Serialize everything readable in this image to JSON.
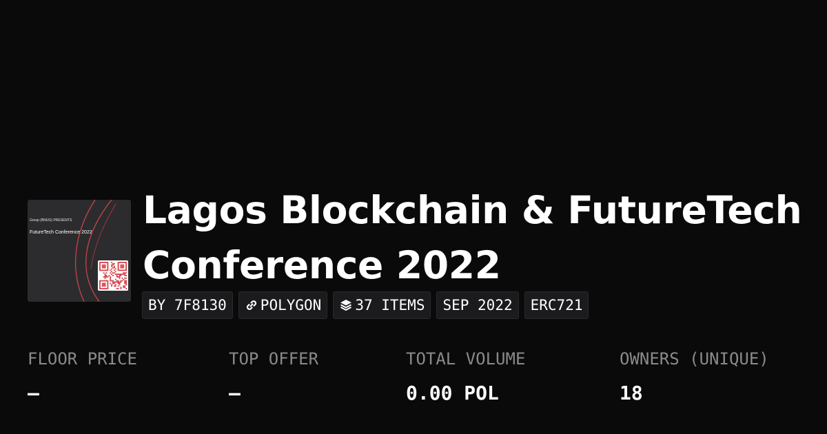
{
  "collection": {
    "title": "Lagos Blockchain & FutureTech Conference 2022",
    "thumbnail": {
      "line1": "Group (BNUG) PRESENTS",
      "line2": "FutureTech Conference 2022"
    }
  },
  "chips": [
    {
      "label": "BY 7F8130"
    },
    {
      "label": "POLYGON",
      "icon": "link-icon"
    },
    {
      "label": "37 ITEMS",
      "icon": "layers-icon"
    },
    {
      "label": "SEP 2022"
    },
    {
      "label": "ERC721"
    }
  ],
  "stats": [
    {
      "label": "FLOOR PRICE",
      "value": "–"
    },
    {
      "label": "TOP OFFER",
      "value": "–"
    },
    {
      "label": "TOTAL VOLUME",
      "value": "0.00 POL"
    },
    {
      "label": "OWNERS (UNIQUE)",
      "value": "18"
    }
  ],
  "colors": {
    "background": "#0a0a0b",
    "chip_background": "#1b1b1d",
    "label_gray": "#8a8a8d",
    "thumb_accent": "#d7444c"
  }
}
